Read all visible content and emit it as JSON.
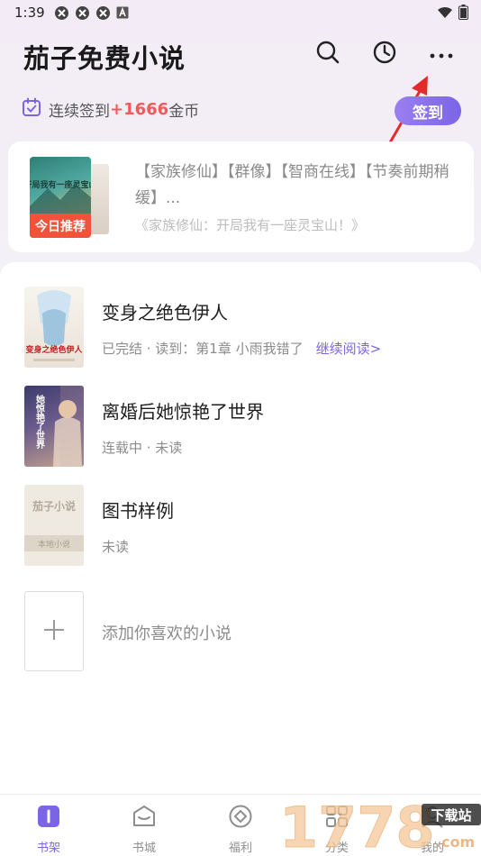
{
  "status_bar": {
    "time": "1:39"
  },
  "header": {
    "title": "茄子免费小说"
  },
  "signin": {
    "prefix": "连续签到",
    "coins": "+1666",
    "suffix": "金币",
    "button": "签到"
  },
  "recommend": {
    "badge": "今日推荐",
    "cover_title": "开局我有一座灵宝山",
    "tags": "【家族修仙】【群像】【智商在线】【节奏前期稍缓】...",
    "subtitle": "《家族修仙：开局我有一座灵宝山！》"
  },
  "books": [
    {
      "title": "变身之绝色伊人",
      "meta": "已完结 · 读到：第1章 小雨我错了",
      "continue": "继续阅读>",
      "cover_text": "变身之绝色伊人"
    },
    {
      "title": "离婚后她惊艳了世界",
      "meta": "连载中 · 未读",
      "cover_text": "她惊艳了世界"
    },
    {
      "title": "图书样例",
      "meta": "未读",
      "cover_text": "茄子小说",
      "cover_sub": "本地小说"
    }
  ],
  "add_book": {
    "label": "添加你喜欢的小说"
  },
  "bottom_nav": [
    {
      "label": "书架",
      "active": true
    },
    {
      "label": "书城",
      "active": false
    },
    {
      "label": "福利",
      "active": false
    },
    {
      "label": "分类",
      "active": false
    },
    {
      "label": "我的",
      "active": false
    }
  ],
  "watermark": {
    "text": "1778",
    "site": "下载站",
    "domain": ".com"
  },
  "colors": {
    "accent": "#7b65e6",
    "coins": "#f25a5a",
    "badge": "#f0533a"
  }
}
